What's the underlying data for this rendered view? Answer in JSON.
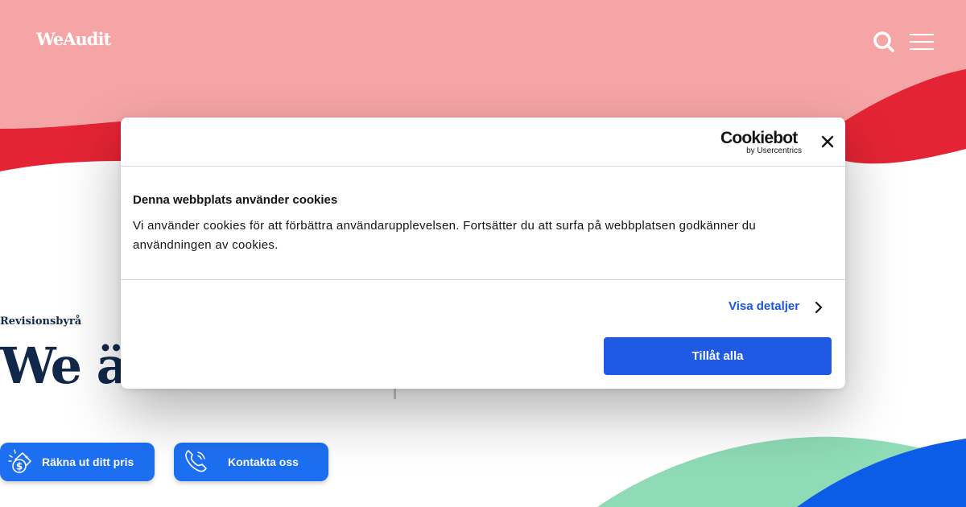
{
  "header": {
    "logo_text": "WeAudit",
    "icons": [
      "search-icon",
      "menu-icon"
    ]
  },
  "hero": {
    "eyebrow": "Revisionsbyrå",
    "title": "We ä"
  },
  "cta": {
    "price_label": "Räkna ut ditt pris",
    "price_icon": "price-tag-icon",
    "contact_label": "Kontakta oss",
    "contact_icon": "phone-icon"
  },
  "cookie_banner": {
    "brand_name": "Cookiebot",
    "brand_sub": "by Usercentrics",
    "title": "Denna webbplats använder cookies",
    "text": "Vi använder cookies för att förbättra användarupplevelsen. Fortsätter du att surfa på webbplatsen godkänner du användningen av cookies.",
    "details_label": "Visa detaljer",
    "allow_label": "Tillåt alla",
    "icons": [
      "close-icon",
      "chevron-right-icon"
    ]
  },
  "colors": {
    "header_pink": "#f6a5a6",
    "wave_red": "#e42434",
    "wave_green": "#8edbb5",
    "wave_blue": "#0b5ce6",
    "navy_text": "#12284a",
    "cta_blue": "#1d6ff2",
    "allow_blue": "#1f5ae5",
    "link_blue": "#1a56db"
  }
}
